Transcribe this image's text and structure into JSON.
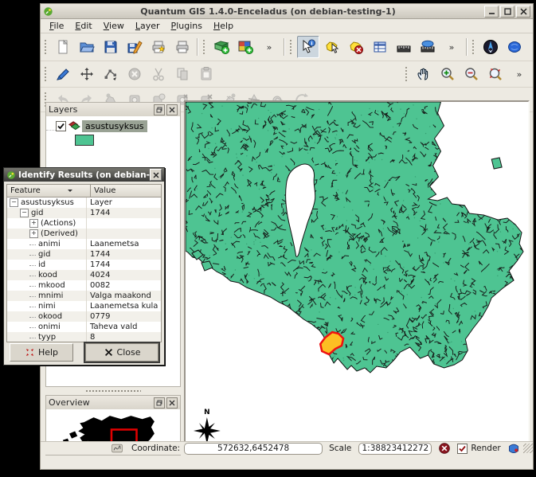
{
  "window": {
    "title": "Quantum GIS 1.4.0-Enceladus (on debian-testing-1)"
  },
  "menu": {
    "items": [
      "File",
      "Edit",
      "View",
      "Layer",
      "Plugins",
      "Help"
    ]
  },
  "toolbars": {
    "row1": [
      {
        "name": "new-project"
      },
      {
        "name": "open-project"
      },
      {
        "name": "save-project"
      },
      {
        "name": "save-project-as"
      },
      {
        "name": "new-print-composer"
      },
      {
        "name": "print"
      },
      {
        "sep": true
      },
      {
        "name": "add-vector-layer"
      },
      {
        "name": "add-raster-layer"
      },
      {
        "name": "toolbar-overflow"
      },
      {
        "sep": true
      },
      {
        "name": "identify-features",
        "active": true
      },
      {
        "name": "select-features"
      },
      {
        "name": "deselect-features"
      },
      {
        "name": "open-attribute-table"
      },
      {
        "name": "measure-line"
      },
      {
        "name": "measure-area"
      },
      {
        "name": "toolbar-overflow"
      },
      {
        "sep": true
      },
      {
        "name": "compass-plugin"
      },
      {
        "name": "globe-plugin"
      }
    ],
    "row2": [
      {
        "name": "toggle-editing"
      },
      {
        "name": "move-feature"
      },
      {
        "name": "node-tool"
      },
      {
        "name": "delete-selected",
        "disabled": true
      },
      {
        "name": "cut-features",
        "disabled": true
      },
      {
        "name": "copy-features",
        "disabled": true
      },
      {
        "name": "paste-features",
        "disabled": true
      },
      {
        "spacer": true
      },
      {
        "name": "pan-map"
      },
      {
        "name": "zoom-in"
      },
      {
        "name": "zoom-out"
      },
      {
        "name": "zoom-full"
      },
      {
        "name": "toolbar-overflow"
      }
    ],
    "row3": [
      {
        "name": "undo",
        "disabled": true
      },
      {
        "name": "redo",
        "disabled": true
      },
      {
        "name": "simplify-feature",
        "disabled": true
      },
      {
        "name": "add-ring",
        "disabled": true
      },
      {
        "name": "add-part",
        "disabled": true
      },
      {
        "name": "delete-ring",
        "disabled": true
      },
      {
        "name": "delete-part",
        "disabled": true
      },
      {
        "name": "reshape-features",
        "disabled": true
      },
      {
        "name": "split-features",
        "disabled": true
      },
      {
        "name": "merge-features",
        "disabled": true
      },
      {
        "name": "rotate-point-symbols",
        "disabled": true
      }
    ]
  },
  "layers_panel": {
    "title": "Layers",
    "layer_name": "asustusyksus",
    "checked": true
  },
  "overview_panel": {
    "title": "Overview"
  },
  "identify_dialog": {
    "title": "Identify Results (on debian-t",
    "feature_column": "Feature",
    "value_column": "Value",
    "rows": [
      {
        "indent": 0,
        "expander": "-",
        "feature": "asustusyksus",
        "value": "Layer"
      },
      {
        "indent": 1,
        "expander": "-",
        "feature": "gid",
        "value": "1744"
      },
      {
        "indent": 2,
        "expander": "+",
        "feature": "(Actions)",
        "value": ""
      },
      {
        "indent": 2,
        "expander": "+",
        "feature": "(Derived)",
        "value": ""
      },
      {
        "indent": 2,
        "feature": "animi",
        "value": "Laanemetsa"
      },
      {
        "indent": 2,
        "feature": "gid",
        "value": "1744"
      },
      {
        "indent": 2,
        "feature": "id",
        "value": "1744"
      },
      {
        "indent": 2,
        "feature": "kood",
        "value": "4024"
      },
      {
        "indent": 2,
        "feature": "mkood",
        "value": "0082"
      },
      {
        "indent": 2,
        "feature": "mnimi",
        "value": "Valga maakond"
      },
      {
        "indent": 2,
        "feature": "nimi",
        "value": "Laanemetsa kula"
      },
      {
        "indent": 2,
        "feature": "okood",
        "value": "0779"
      },
      {
        "indent": 2,
        "feature": "onimi",
        "value": "Taheva vald"
      },
      {
        "indent": 2,
        "feature": "tyyp",
        "value": "8"
      }
    ],
    "help_button": "Help",
    "close_button": "Close"
  },
  "statusbar": {
    "coordinate_label": "Coordinate:",
    "coordinate_value": "572632,6452478",
    "scale_label": "Scale",
    "scale_value": "1:38823412272",
    "render_label": "Render",
    "render_checked": true
  },
  "map": {
    "north_label": "N",
    "land_color": "#4ec492",
    "boundary_color": "#141414",
    "highlight_fill": "#fcbe23",
    "highlight_stroke": "#ee1111",
    "lake_color": "#ffffff",
    "background": "#ffffff",
    "overview_extent_color": "#e00000"
  }
}
